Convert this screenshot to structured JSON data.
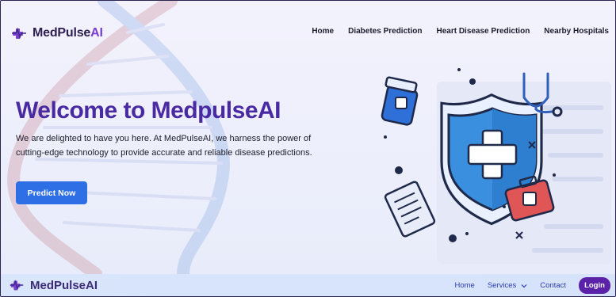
{
  "header": {
    "brand_part1": "MedPulse",
    "brand_part2": "AI",
    "nav": [
      "Home",
      "Diabetes Prediction",
      "Heart Disease Prediction",
      "Nearby Hospitals"
    ]
  },
  "hero": {
    "title": "Welcome to MedpulseAI",
    "description": "We are delighted to have you here. At MedPulseAI, we harness the power of cutting-edge technology to provide accurate and reliable disease predictions.",
    "cta_label": "Predict Now"
  },
  "footer_bar": {
    "brand": "MedPulseAI",
    "home": "Home",
    "services": "Services",
    "contact": "Contact",
    "login": "Login"
  },
  "colors": {
    "brand_purple": "#4a2aa2",
    "accent_purple": "#7a3fd0",
    "cta_blue": "#2f6fe6",
    "login_purple": "#5b21a8"
  }
}
